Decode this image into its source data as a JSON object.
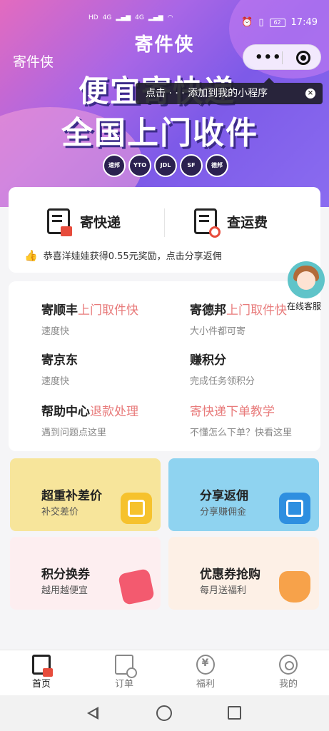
{
  "status_bar": {
    "network_left": "4G",
    "network_right": "4G",
    "battery": "62",
    "time": "17:49"
  },
  "header": {
    "title": "寄件侠",
    "left_title": "寄件侠",
    "capsule_menu": "•••",
    "tooltip": "点击 · · · 添加到我的小程序",
    "tooltip_close": "×"
  },
  "banner": {
    "slogan_line1": "便宜寄快递",
    "slogan_line2": "全国上门收件",
    "carriers": [
      "速邦",
      "YTO",
      "JDL",
      "SF",
      "德邦"
    ]
  },
  "quick_actions": {
    "send": "寄快递",
    "check_fee": "查运费",
    "notice": "恭喜洋娃娃获得0.55元奖励，点击分享返佣"
  },
  "services": [
    {
      "title": "寄顺丰",
      "highlight": "上门取件快",
      "subtitle": "速度快"
    },
    {
      "title": "寄德邦",
      "highlight": "上门取件快",
      "subtitle": "大小件都可寄"
    },
    {
      "title": "寄京东",
      "highlight": "",
      "subtitle": "速度快"
    },
    {
      "title": "赚积分",
      "highlight": "",
      "subtitle": "完成任务领积分"
    },
    {
      "title": "帮助中心",
      "highlight": "退款处理",
      "subtitle": "遇到问题点这里"
    },
    {
      "title": "",
      "highlight": "寄快递下单教学",
      "subtitle": "不懂怎么下单？快看这里"
    }
  ],
  "customer_service": {
    "label": "在线客服"
  },
  "tiles": [
    {
      "title": "超重补差价",
      "subtitle": "补交差价",
      "color": "#f7e59b"
    },
    {
      "title": "分享返佣",
      "subtitle": "分享赚佣金",
      "color": "#8fd3f0"
    },
    {
      "title": "积分换券",
      "subtitle": "越用越便宜",
      "color": "#fdeef0"
    },
    {
      "title": "优惠券抢购",
      "subtitle": "每月送福利",
      "color": "#fdf0e6"
    }
  ],
  "tabbar": {
    "items": [
      {
        "label": "首页",
        "icon": "home-doc-icon",
        "active": true
      },
      {
        "label": "订单",
        "icon": "order-search-icon",
        "active": false
      },
      {
        "label": "福利",
        "icon": "yen-coin-icon",
        "active": false
      },
      {
        "label": "我的",
        "icon": "profile-icon",
        "active": false
      }
    ]
  }
}
